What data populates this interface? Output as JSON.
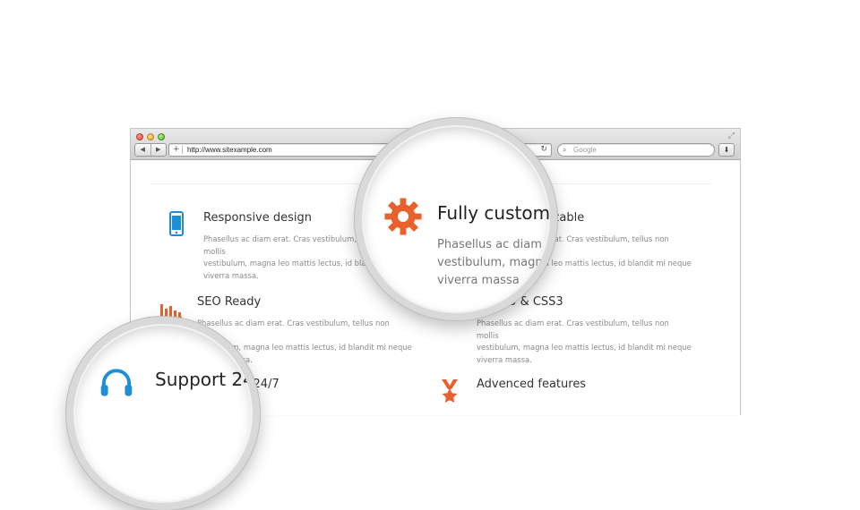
{
  "browser": {
    "url": "http://www.sitexample.com",
    "search_placeholder": "Google"
  },
  "features": [
    {
      "title": "Responsive design",
      "icon": "mobile-phone-icon",
      "desc_lines": [
        "Phasellus ac diam erat. Cras vestibulum, tellus non mollis",
        "vestibulum, magna leo mattis lectus, id blandit mi neque",
        "viverra massa."
      ]
    },
    {
      "title": "Fully customizable",
      "icon": "gear-icon",
      "desc_lines": [
        "Phasellus ac diam erat. Cras vestibulum, tellus non mollis",
        "vestibulum, magna leo mattis lectus, id blandit mi neque",
        "viverra massa."
      ]
    },
    {
      "title": "SEO Ready",
      "icon": "bar-chart-icon",
      "desc_lines": [
        "Phasellus ac diam erat. Cras vestibulum, tellus non mollis",
        "vestibulum, magna leo mattis lectus, id blandit mi neque",
        "viverra massa."
      ]
    },
    {
      "title": "HTML5 & CSS3",
      "icon": "globe-icon",
      "desc_lines": [
        "Phasellus ac diam erat. Cras vestibulum, tellus non mollis",
        "vestibulum, magna leo mattis lectus, id blandit mi neque",
        "viverra massa."
      ]
    },
    {
      "title": "Support 24/7",
      "icon": "headset-icon",
      "desc_lines": []
    },
    {
      "title": "Advenced features",
      "icon": "award-icon",
      "desc_lines": []
    }
  ],
  "magnifier_top": {
    "title": "Fully custom",
    "desc_lines": [
      "Phasellus ac diam",
      "vestibulum, magna",
      "viverra massa"
    ]
  },
  "magnifier_bottom": {
    "title": "Support 24"
  },
  "colors": {
    "orange": "#e8612c",
    "blue": "#1e8fd6",
    "text": "#333333",
    "muted": "#8a8a8a"
  }
}
